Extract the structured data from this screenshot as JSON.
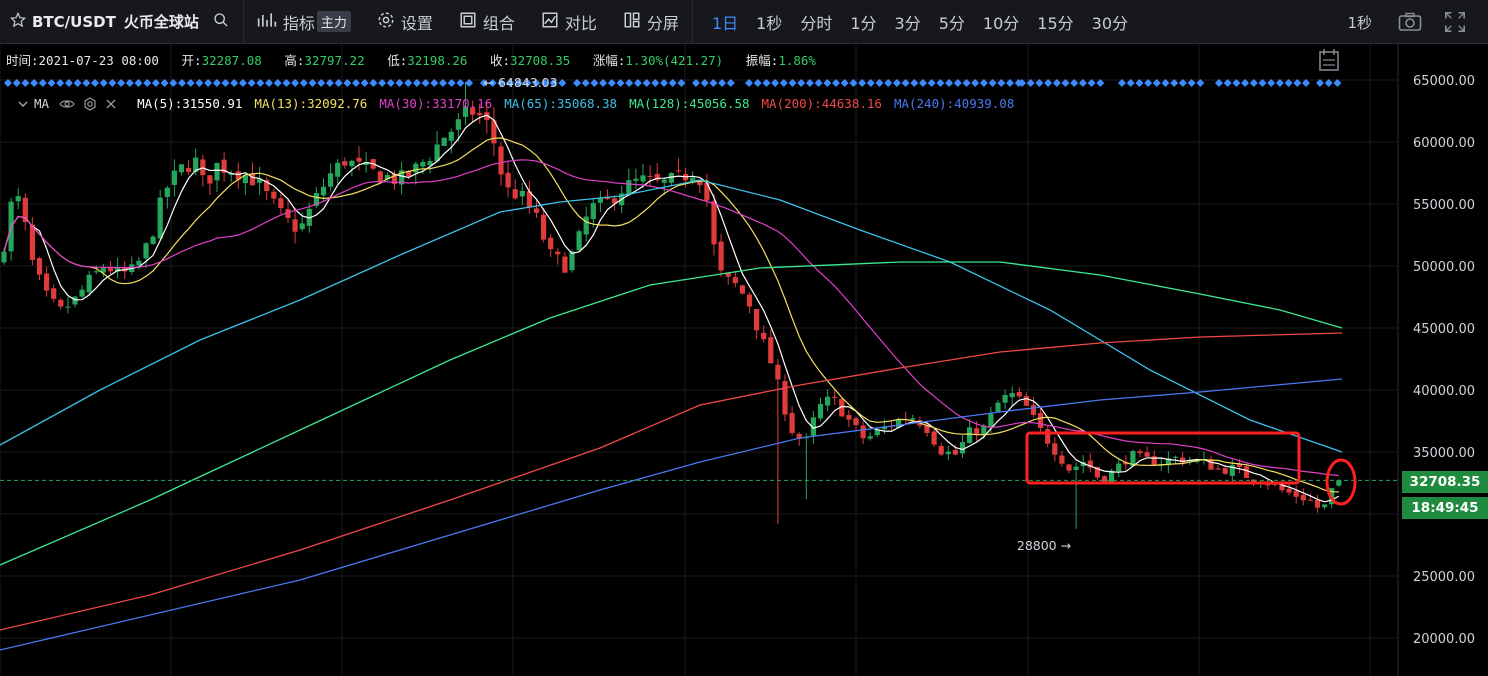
{
  "toolbar": {
    "symbol": "BTC/USDT",
    "exchange": "火币全球站",
    "indicators_label": "指标",
    "indicators_badge": "主力",
    "settings_label": "设置",
    "combine_label": "组合",
    "compare_label": "对比",
    "split_label": "分屏",
    "intervals": [
      "1日",
      "1秒",
      "分时",
      "1分",
      "3分",
      "5分",
      "10分",
      "15分",
      "30分"
    ],
    "active_interval": "1日",
    "right_interval": "1秒",
    "icons": [
      "star-icon",
      "search-icon",
      "indicators-icon",
      "gear-icon",
      "combine-icon",
      "compare-icon",
      "split-icon",
      "camera-icon",
      "fullscreen-icon"
    ]
  },
  "info": {
    "time_label": "时间:",
    "time": "2021-07-23 08:00",
    "open_label": "开:",
    "open": "32287.08",
    "high_label": "高:",
    "high": "32797.22",
    "low_label": "低:",
    "low": "32198.26",
    "close_label": "收:",
    "close": "32708.35",
    "change_label": "涨幅:",
    "change": "1.30%(421.27)",
    "amp_label": "振幅:",
    "amp": "1.86%"
  },
  "ma": {
    "label": "MA",
    "items": [
      {
        "label": "MA(5):31550.91",
        "color": "#ffffff"
      },
      {
        "label": "MA(13):32092.76",
        "color": "#f3e060"
      },
      {
        "label": "MA(30):33170.16",
        "color": "#e040c8"
      },
      {
        "label": "MA(65):35068.38",
        "color": "#3cc0e8"
      },
      {
        "label": "MA(128):45056.58",
        "color": "#3ce890"
      },
      {
        "label": "MA(200):44638.16",
        "color": "#f04848"
      },
      {
        "label": "MA(240):40939.08",
        "color": "#4a78f0"
      }
    ]
  },
  "chart_data": {
    "type": "candlestick",
    "y_ticks": [
      "65000.00",
      "60000.00",
      "55000.00",
      "50000.00",
      "45000.00",
      "40000.00",
      "35000.00",
      "30000.00",
      "25000.00",
      "20000.00"
    ],
    "ylim": [
      17500,
      67000
    ],
    "current_price": "32708.35",
    "countdown": "18:49:45",
    "high_annotation": "64843.03",
    "low_annotation": "28800",
    "colors": {
      "up": "#26a65b",
      "down": "#e03b3b",
      "price_tag": "#1f8b3e",
      "marker": "#3d8bff",
      "highlight": "#ff2020"
    }
  }
}
